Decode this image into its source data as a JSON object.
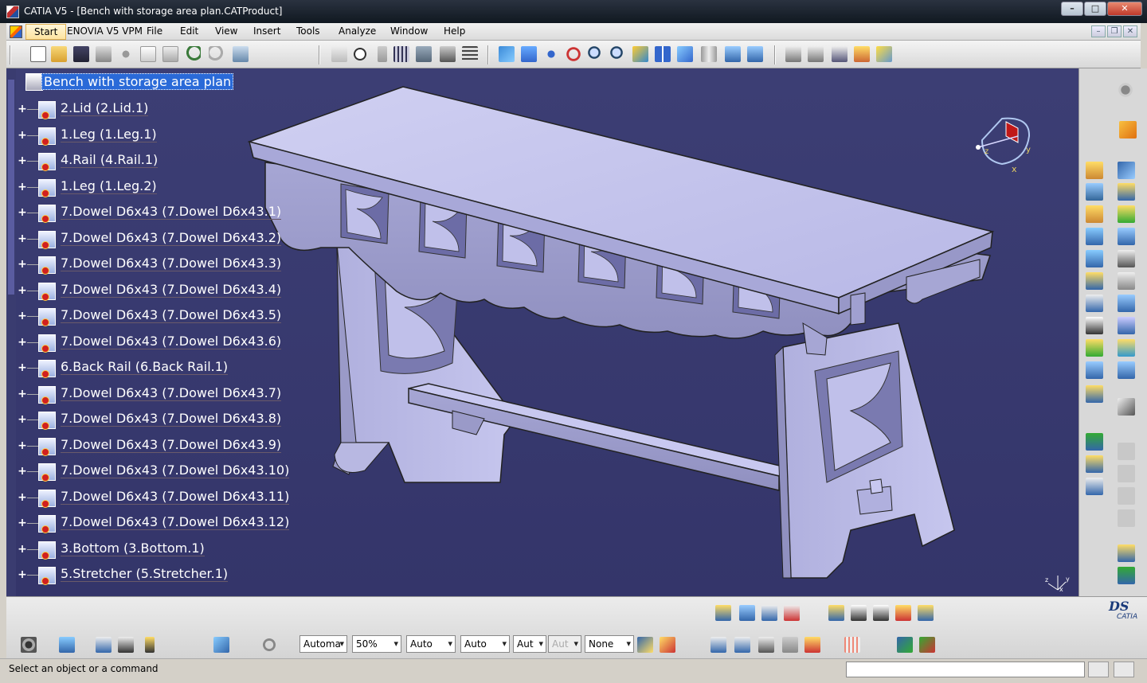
{
  "window": {
    "title": "CATIA V5 - [Bench with storage area plan.CATProduct]",
    "min_glyph": "–",
    "max_glyph": "□",
    "close_glyph": "✕",
    "doc_min_glyph": "–",
    "doc_restore_glyph": "❐",
    "doc_close_glyph": "✕"
  },
  "menu": {
    "start": "Start",
    "items": [
      "ENOVIA V5 VPM",
      "File",
      "Edit",
      "View",
      "Insert",
      "Tools",
      "Analyze",
      "Window",
      "Help"
    ]
  },
  "tree": {
    "root": "Bench with storage area plan",
    "nodes": [
      "2.Lid (2.Lid.1)",
      "1.Leg (1.Leg.1)",
      "4.Rail (4.Rail.1)",
      "1.Leg (1.Leg.2)",
      "7.Dowel D6x43 (7.Dowel D6x43.1)",
      "7.Dowel D6x43 (7.Dowel D6x43.2)",
      "7.Dowel D6x43 (7.Dowel D6x43.3)",
      "7.Dowel D6x43 (7.Dowel D6x43.4)",
      "7.Dowel D6x43 (7.Dowel D6x43.5)",
      "7.Dowel D6x43 (7.Dowel D6x43.6)",
      "6.Back Rail (6.Back Rail.1)",
      "7.Dowel D6x43 (7.Dowel D6x43.7)",
      "7.Dowel D6x43 (7.Dowel D6x43.8)",
      "7.Dowel D6x43 (7.Dowel D6x43.9)",
      "7.Dowel D6x43 (7.Dowel D6x43.10)",
      "7.Dowel D6x43 (7.Dowel D6x43.11)",
      "7.Dowel D6x43 (7.Dowel D6x43.12)",
      "3.Bottom (3.Bottom.1)",
      "5.Stretcher (5.Stretcher.1)"
    ]
  },
  "viewport": {
    "compass_labels": {
      "x": "x",
      "y": "y",
      "z": "z"
    },
    "mini_axes": {
      "x": "x",
      "y": "y",
      "z": "z"
    }
  },
  "bottom_toolbar": {
    "combos": {
      "line_type": "Automa",
      "transparency": "50%",
      "thickness": "Auto",
      "line_style": "Auto",
      "layer_short": "Aut",
      "disabled_short": "Aut",
      "rendering": "None"
    }
  },
  "logo": {
    "ds": "DS",
    "catia": "CATIA"
  },
  "status": {
    "message": "Select an object or a command"
  },
  "colors": {
    "viewport_bg": "#383a70",
    "selection": "#2a6ad8",
    "part_face": "#c6c6ee"
  }
}
